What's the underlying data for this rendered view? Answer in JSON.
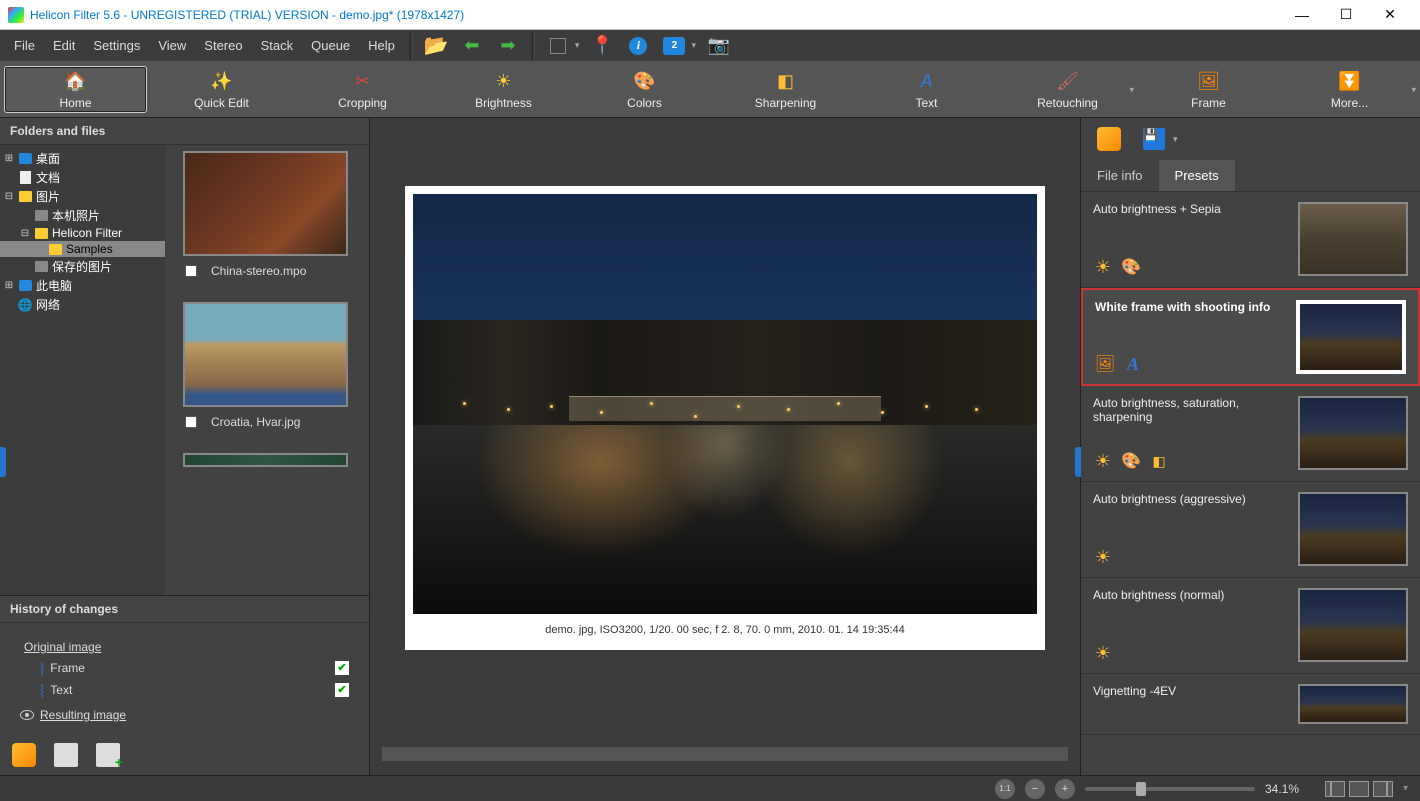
{
  "window": {
    "title": "Helicon Filter 5.6 - UNREGISTERED (TRIAL) VERSION - demo.jpg* (1978x1427)"
  },
  "menu": [
    "File",
    "Edit",
    "Settings",
    "View",
    "Stereo",
    "Stack",
    "Queue",
    "Help"
  ],
  "toolbar_monitor_badge": "2",
  "ribbon": [
    {
      "label": "Home",
      "icon": "home"
    },
    {
      "label": "Quick Edit",
      "icon": "wand"
    },
    {
      "label": "Cropping",
      "icon": "crop"
    },
    {
      "label": "Brightness",
      "icon": "sun"
    },
    {
      "label": "Colors",
      "icon": "palette"
    },
    {
      "label": "Sharpening",
      "icon": "sharp"
    },
    {
      "label": "Text",
      "icon": "text"
    },
    {
      "label": "Retouching",
      "icon": "brush"
    },
    {
      "label": "Frame",
      "icon": "frame"
    },
    {
      "label": "More...",
      "icon": "more"
    }
  ],
  "ribbon_selected": 0,
  "left": {
    "folders_title": "Folders and files",
    "tree": {
      "desktop": "桌面",
      "documents": "文档",
      "pictures": "图片",
      "local_photos": "本机照片",
      "helicon_filter": "Helicon Filter",
      "samples": "Samples",
      "saved_pictures": "保存的图片",
      "this_pc": "此电脑",
      "network": "网络"
    },
    "thumbs": [
      {
        "caption": "China-stereo.mpo"
      },
      {
        "caption": "Croatia, Hvar.jpg"
      }
    ],
    "history_title": "History of changes",
    "history": {
      "original": "Original image",
      "frame": "Frame",
      "text": "Text",
      "resulting": "Resulting image"
    }
  },
  "center": {
    "caption": "demo. jpg, ISO3200, 1/20. 00 sec, f 2. 8, 70. 0 mm, 2010. 01. 14 19:35:44"
  },
  "right": {
    "tab_fileinfo": "File info",
    "tab_presets": "Presets",
    "presets": [
      {
        "title": "Auto brightness + Sepia"
      },
      {
        "title": "White frame with shooting info"
      },
      {
        "title": "Auto brightness, saturation, sharpening"
      },
      {
        "title": "Auto brightness (aggressive)"
      },
      {
        "title": "Auto brightness (normal)"
      },
      {
        "title": "Vignetting -4EV"
      }
    ],
    "selected_preset": 1
  },
  "status": {
    "zoom": "34.1%",
    "fit_label": "1:1"
  }
}
